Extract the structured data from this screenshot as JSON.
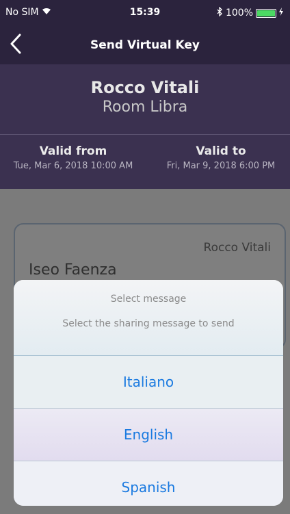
{
  "status": {
    "carrier": "No SIM",
    "time": "15:39",
    "battery": "100%",
    "battery_level": 1.0,
    "battery_color": "#4cd964"
  },
  "nav": {
    "back_icon": "chevron-left-icon",
    "title": "Send Virtual Key"
  },
  "guest": {
    "name": "Rocco Vitali",
    "room": "Room Libra"
  },
  "validity": {
    "from_label": "Valid from",
    "from_value": "Tue, Mar 6, 2018 10:00 AM",
    "to_label": "Valid to",
    "to_value": "Fri, Mar 9, 2018 6:00 PM"
  },
  "card": {
    "guest": "Rocco Vitali",
    "place": "Iseo Faenza"
  },
  "sheet": {
    "title": "Select message",
    "message": "Select the sharing message to send",
    "options": [
      {
        "label": "Italiano"
      },
      {
        "label": "English"
      },
      {
        "label": "Spanish"
      }
    ],
    "option_color": "#1a7ae0"
  }
}
